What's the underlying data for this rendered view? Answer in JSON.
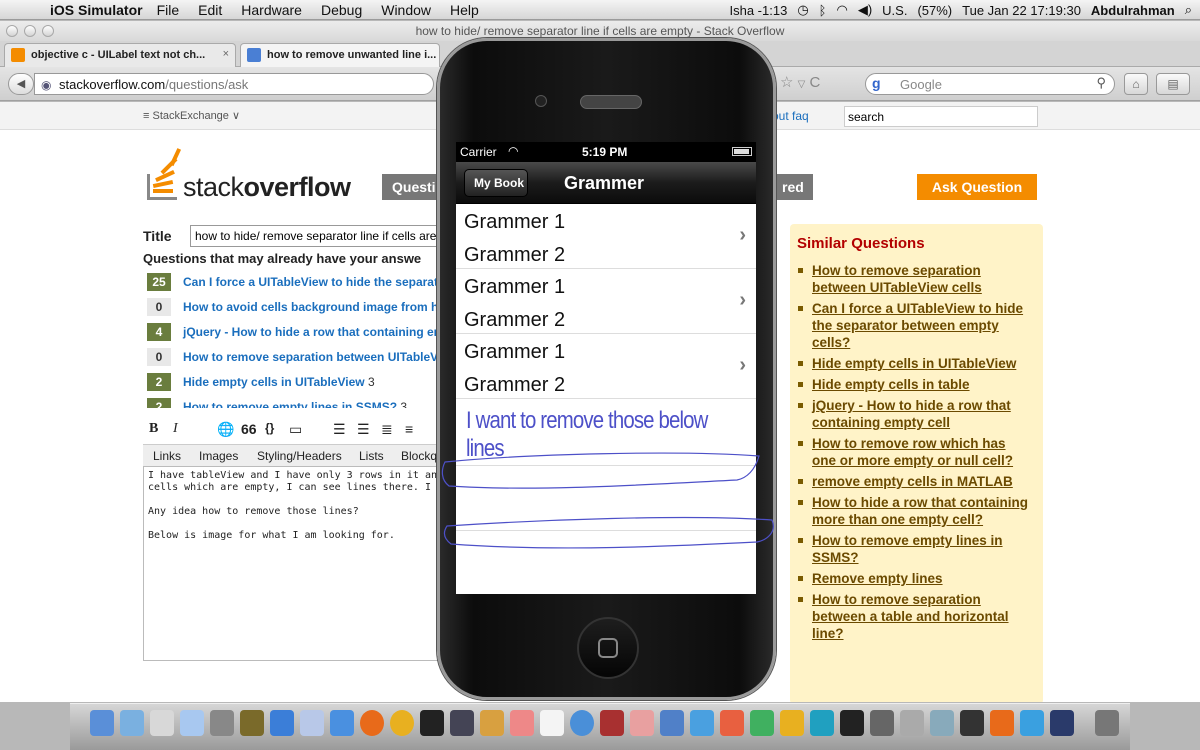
{
  "menubar": {
    "app": "iOS Simulator",
    "items": [
      "File",
      "Edit",
      "Hardware",
      "Debug",
      "Window",
      "Help"
    ],
    "status_user": "Isha -1:13",
    "country": "U.S.",
    "battery": "(57%)",
    "datetime": "Tue Jan 22  17:19:30",
    "username": "Abdulrahman"
  },
  "browser": {
    "window_title": "how to hide/ remove separator line if cells are empty - Stack Overflow",
    "tabs": [
      {
        "label": "objective c - UILabel text not ch...",
        "close": "×"
      },
      {
        "label": "how to remove unwanted line i..."
      }
    ],
    "url_host": "stackoverflow.com",
    "url_path": "/questions/ask",
    "search_placeholder": "Google"
  },
  "page": {
    "stackexchange_label": "StackExchange",
    "links": "out   faq",
    "site_search": "search",
    "logo_light": "stack",
    "logo_bold": "overflow",
    "questions_tab": "Questi",
    "unanswered_tab": "red",
    "ask_button": "Ask Question",
    "title_label": "Title",
    "title_value": "how to hide/ remove separator line if cells are",
    "already_heading": "Questions that may already have your answe",
    "suggestions": [
      {
        "count": "25",
        "text": "Can I force a UITableView to hide the separat",
        "num": ""
      },
      {
        "count": "0",
        "text": "How to avoid cells background image from h",
        "num": ""
      },
      {
        "count": "4",
        "text": "jQuery - How to hide a row that containing er",
        "num": ""
      },
      {
        "count": "0",
        "text": "How to remove separation between UITableV",
        "num": ""
      },
      {
        "count": "2",
        "text": "Hide empty cells in UITableView",
        "num": "3"
      },
      {
        "count": "2",
        "text": "How to remove empty lines in SSMS?",
        "num": "3"
      }
    ],
    "editor_toolbar": {
      "bold": "B",
      "italic": "I",
      "quote": "66",
      "code": "{}"
    },
    "editor_tabs": [
      "Links",
      "Images",
      "Styling/Headers",
      "Lists",
      "Blockq"
    ],
    "editor_text": "I have tableView and I have only 3 rows in it and\ncells which are empty, I can see lines there. I d\n\nAny idea how to remove those lines?\n\nBelow is image for what I am looking for.",
    "similar_heading": "Similar Questions",
    "similar": [
      "How to remove separation between UITableView cells",
      "Can I force a UITableView to hide the separator between empty cells?",
      "Hide empty cells in UITableView",
      "Hide empty cells in table",
      "jQuery - How to hide a row that containing empty cell",
      "How to remove row which has one or more empty or null cell?",
      "remove empty cells in MATLAB",
      "How to hide a row that containing more than one empty cell?",
      "How to remove empty lines in SSMS?",
      "Remove empty lines",
      "How to remove separation between a table and horizontal line?"
    ]
  },
  "simulator": {
    "carrier": "Carrier",
    "time": "5:19 PM",
    "back_label": "My Book",
    "nav_title": "Grammer",
    "cells": [
      {
        "line1": "Grammer  1",
        "line2": "Grammer  2"
      },
      {
        "line1": "Grammer  1",
        "line2": "Grammer  2"
      },
      {
        "line1": "Grammer  1",
        "line2": "Grammer  2"
      }
    ],
    "annotation": "I want to remove those below lines"
  },
  "colors": {
    "accent_orange": "#f48c00",
    "so_link_blue": "#1a6ebd",
    "similar_bg": "#fff3c8",
    "annotation_ink": "#4d50c8"
  }
}
